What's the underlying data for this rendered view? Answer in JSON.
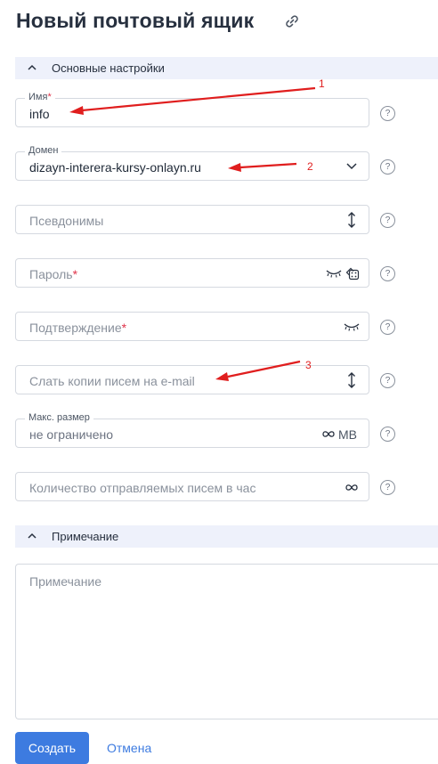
{
  "page": {
    "title": "Новый почтовый ящик"
  },
  "icons": {
    "link": "link-icon",
    "chevron": "chevron-up-icon",
    "help": "help-circle-icon",
    "dropdown": "chevron-down-icon",
    "resize": "vertical-resize-icon",
    "eye_closed": "eye-closed-icon",
    "dice": "generate-password-icon",
    "infinity": "infinity-icon"
  },
  "sections": {
    "basic": {
      "label": "Основные настройки"
    },
    "note": {
      "label": "Примечание"
    }
  },
  "fields": {
    "name": {
      "label": "Имя",
      "required": "*",
      "value": "info"
    },
    "domain": {
      "label": "Домен",
      "value": "dizayn-interera-kursy-onlayn.ru"
    },
    "aliases": {
      "placeholder": "Псевдонимы"
    },
    "password": {
      "placeholder": "Пароль",
      "required": "*"
    },
    "confirm": {
      "placeholder": "Подтверждение",
      "required": "*"
    },
    "copies": {
      "placeholder": "Слать копии писем на e-mail"
    },
    "max_size": {
      "label": "Макс. размер",
      "placeholder": "не ограничено",
      "unit": "MB"
    },
    "send_limit": {
      "placeholder": "Количество отправляемых писем в час"
    }
  },
  "note": {
    "placeholder": "Примечание"
  },
  "help": {
    "symbol": "?"
  },
  "buttons": {
    "create": "Создать",
    "cancel": "Отмена"
  },
  "annotations": {
    "color": "#e01e1e",
    "labels": [
      "1",
      "2",
      "3"
    ]
  },
  "colors": {
    "accent": "#3d7be0",
    "required": "#e0334a",
    "section_bg": "#eef1fb"
  }
}
